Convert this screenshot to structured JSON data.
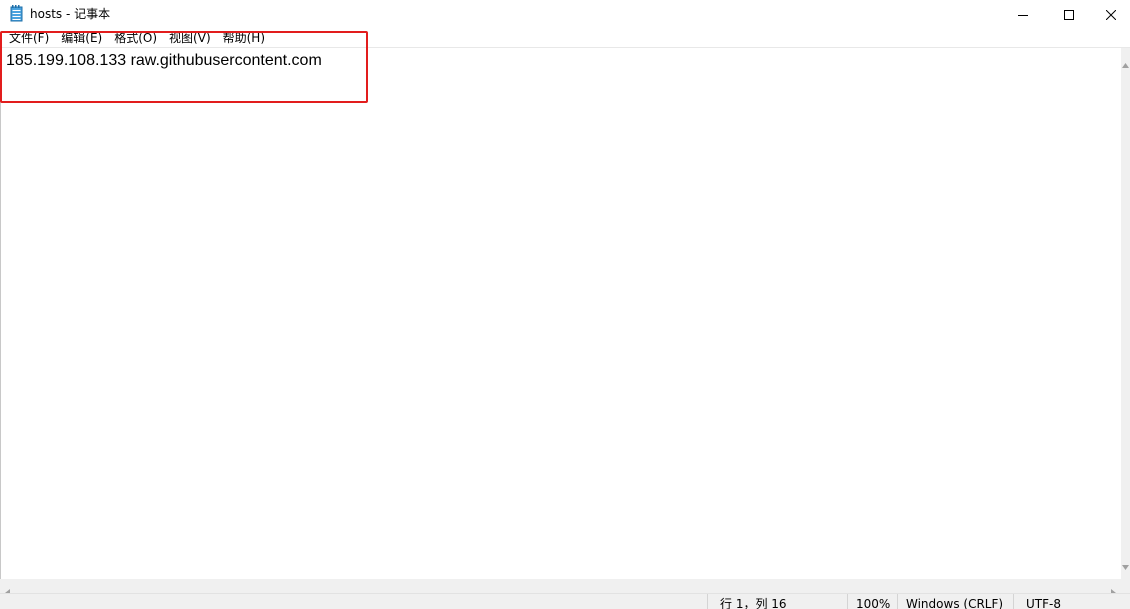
{
  "window": {
    "title": "hosts - 记事本"
  },
  "menu": {
    "items": [
      {
        "label": "文件(F)"
      },
      {
        "label": "编辑(E)"
      },
      {
        "label": "格式(O)"
      },
      {
        "label": "视图(V)"
      },
      {
        "label": "帮助(H)"
      }
    ]
  },
  "editor": {
    "content": "185.199.108.133 raw.githubusercontent.com"
  },
  "status": {
    "position": "行 1，列 16",
    "zoom": "100%",
    "line_ending": "Windows (CRLF)",
    "encoding": "UTF-8"
  },
  "icons": {
    "app": "notepad-icon",
    "minimize": "minimize-icon",
    "maximize": "maximize-icon",
    "close": "close-icon"
  },
  "colors": {
    "highlight": "#e21d1d",
    "scrollbar": "#f0f0f0",
    "statusbar": "#f0f0f0"
  }
}
